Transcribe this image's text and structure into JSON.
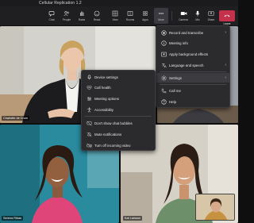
{
  "window": {
    "title": "Cellular Replication 1.2"
  },
  "toolbar": {
    "buttons": [
      {
        "label": "Chat",
        "icon": "chat-icon"
      },
      {
        "label": "People",
        "icon": "people-icon"
      },
      {
        "label": "Raise",
        "icon": "raise-hand-icon"
      },
      {
        "label": "React",
        "icon": "react-icon"
      },
      {
        "label": "View",
        "icon": "view-icon"
      },
      {
        "label": "Rooms",
        "icon": "rooms-icon"
      },
      {
        "label": "Apps",
        "icon": "apps-icon"
      },
      {
        "label": "More",
        "icon": "more-icon"
      },
      {
        "label": "Camera",
        "icon": "camera-icon"
      },
      {
        "label": "Mic",
        "icon": "mic-icon"
      },
      {
        "label": "Share",
        "icon": "share-icon"
      }
    ],
    "leave_label": "Leave"
  },
  "participants": [
    {
      "name": "Charlotte de Crum"
    },
    {
      "name": ""
    },
    {
      "name": "Serena Ribas"
    },
    {
      "name": "Kat Larsson"
    }
  ],
  "more_menu": {
    "items": [
      {
        "label": "Record and transcribe",
        "icon": "record-icon",
        "submenu": true
      },
      {
        "label": "Meeting info",
        "icon": "info-icon",
        "submenu": false
      },
      {
        "label": "Apply background effects",
        "icon": "background-effects-icon",
        "submenu": false
      },
      {
        "label": "Language and speech",
        "icon": "language-icon",
        "submenu": true
      },
      {
        "label": "Settings",
        "icon": "gear-icon",
        "submenu": true
      },
      {
        "label": "Call me",
        "icon": "phone-icon",
        "submenu": false
      },
      {
        "label": "Help",
        "icon": "help-icon",
        "submenu": false
      }
    ]
  },
  "settings_submenu": {
    "items": [
      {
        "label": "Device settings",
        "icon": "device-settings-icon"
      },
      {
        "label": "Call health",
        "icon": "call-health-icon"
      },
      {
        "label": "Meeting options",
        "icon": "meeting-options-icon"
      },
      {
        "label": "Accessibility",
        "icon": "accessibility-icon"
      },
      {
        "label": "Don't show chat bubbles",
        "icon": "chat-bubble-off-icon"
      },
      {
        "label": "Mute notifications",
        "icon": "bell-off-icon"
      },
      {
        "label": "Turn off incoming video",
        "icon": "video-off-icon"
      }
    ]
  },
  "colors": {
    "accent": "#6264a7",
    "leave": "#c4314b",
    "menu_bg": "#2b2b2e"
  }
}
